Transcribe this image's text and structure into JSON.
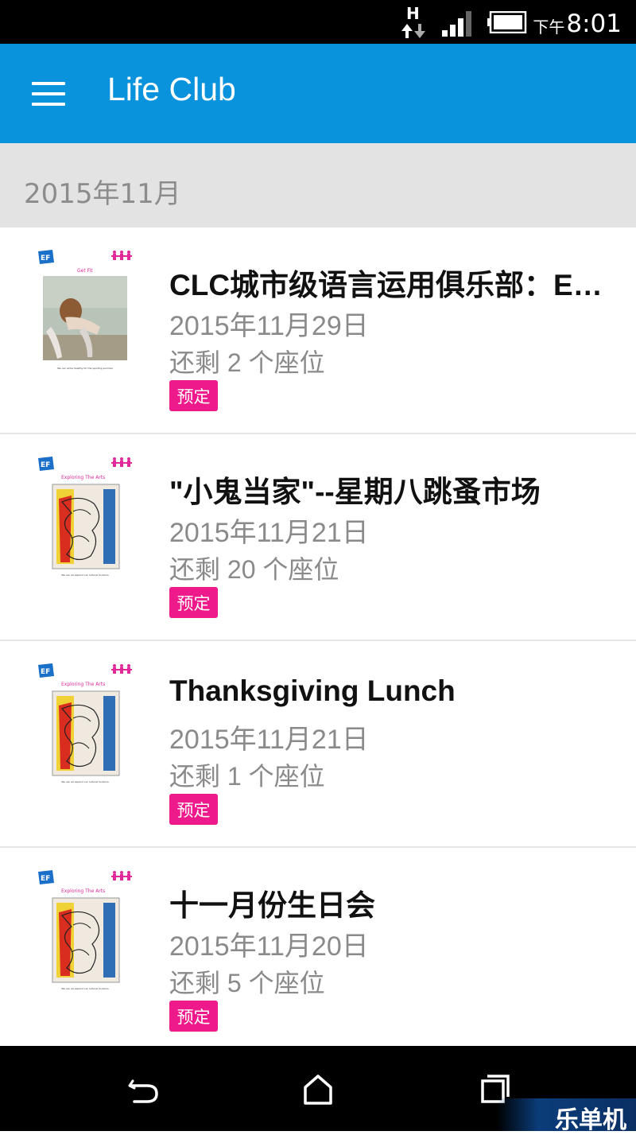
{
  "status_bar": {
    "network_type": "H",
    "ampm": "下午",
    "time": "8:01",
    "icons": [
      "data-transfer-icon",
      "signal-strength-icon",
      "battery-icon"
    ]
  },
  "app_bar": {
    "title": "Life Club",
    "menu_icon": "hamburger-menu-icon",
    "color": "#0a93dd"
  },
  "section": {
    "date_header": "2015年11月"
  },
  "events": [
    {
      "title": "CLC城市级语言运用俱乐部：EF Get Fit",
      "date": "2015年11月29日",
      "seats": "还剩 2 个座位",
      "book_label": "预定",
      "thumbnail": {
        "brand": "EF",
        "heading": "Get Fit",
        "caption": "We can all be healthy for the sporting summer"
      }
    },
    {
      "title": "\"小鬼当家\"--星期八跳蚤市场",
      "date": "2015年11月21日",
      "seats": "还剩 20 个座位",
      "book_label": "预定",
      "thumbnail": {
        "brand": "EF",
        "heading": "Exploring The Arts",
        "caption": "We can all expand our cultural horizons"
      }
    },
    {
      "title": "Thanksgiving Lunch",
      "date": "2015年11月21日",
      "seats": "还剩 1 个座位",
      "book_label": "预定",
      "thumbnail": {
        "brand": "EF",
        "heading": "Exploring The Arts",
        "caption": "We can all expand our cultural horizons"
      }
    },
    {
      "title": "十一月份生日会",
      "date": "2015年11月20日",
      "seats": "还剩 5 个座位",
      "book_label": "预定",
      "thumbnail": {
        "brand": "EF",
        "heading": "Exploring The Arts",
        "caption": "We can all expand our cultural horizons"
      }
    }
  ],
  "nav_bar": {
    "icons": [
      "back-icon",
      "home-icon",
      "recent-apps-icon"
    ]
  },
  "watermark": "乐单机",
  "colors": {
    "accent": "#0a93dd",
    "book_button": "#ee1a8c",
    "section_bg": "#e3e3e3"
  }
}
